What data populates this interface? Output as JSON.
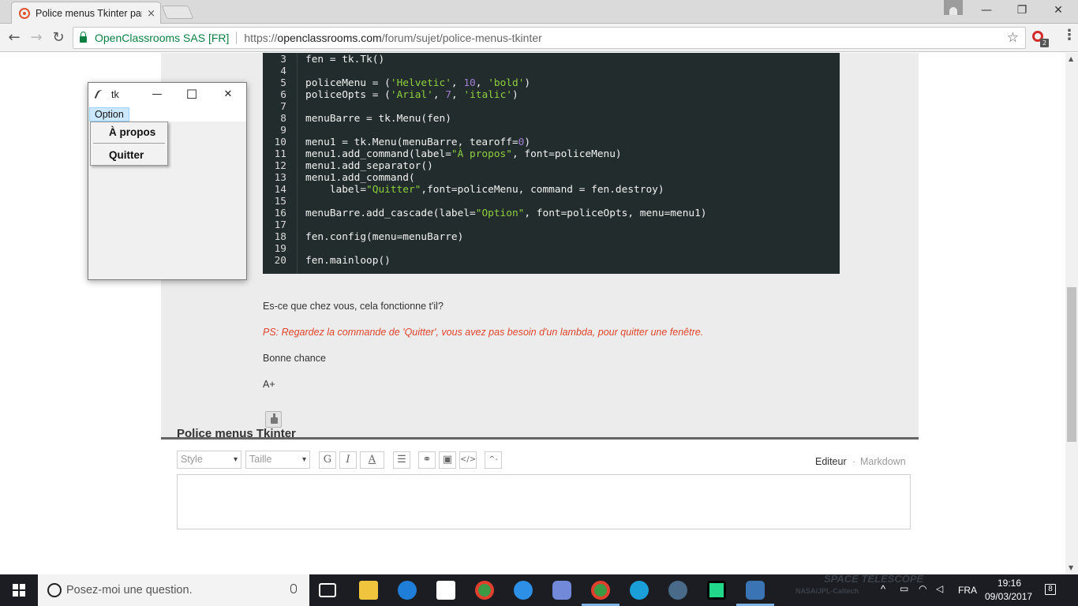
{
  "browser": {
    "tab_title": "Police menus Tkinter par",
    "tab_close": "×",
    "site_name": "OpenClassrooms SAS [FR]",
    "url_scheme": "https://",
    "url_host": "openclassrooms.com",
    "url_path": "/forum/sujet/police-menus-tkinter",
    "back": "←",
    "forward": "→",
    "reload": "↻",
    "star": "☆",
    "menu": "⋮",
    "minimize": "—",
    "maximize": "❐",
    "close": "✕",
    "extension_badge": "2"
  },
  "code": {
    "lines": [
      {
        "n": "3",
        "text": "fen = tk.Tk()"
      },
      {
        "n": "4",
        "text": ""
      },
      {
        "n": "5",
        "parts": [
          [
            "policeMenu = (",
            ""
          ],
          [
            "'Helvetic'",
            "s"
          ],
          [
            ", ",
            ""
          ],
          [
            "10",
            "n"
          ],
          [
            ", ",
            ""
          ],
          [
            "'bold'",
            "s"
          ],
          [
            ")",
            ""
          ]
        ]
      },
      {
        "n": "6",
        "parts": [
          [
            "policeOpts = (",
            ""
          ],
          [
            "'Arial'",
            "s"
          ],
          [
            ", ",
            ""
          ],
          [
            "7",
            "n"
          ],
          [
            ", ",
            ""
          ],
          [
            "'italic'",
            "s"
          ],
          [
            ")",
            ""
          ]
        ]
      },
      {
        "n": "7",
        "text": ""
      },
      {
        "n": "8",
        "text": "menuBarre = tk.Menu(fen)"
      },
      {
        "n": "9",
        "text": ""
      },
      {
        "n": "10",
        "parts": [
          [
            "menu1 = tk.Menu(menuBarre, tearoff=",
            ""
          ],
          [
            "0",
            "n"
          ],
          [
            ")",
            ""
          ]
        ]
      },
      {
        "n": "11",
        "parts": [
          [
            "menu1.add_command(label=",
            ""
          ],
          [
            "\"À propos\"",
            "s"
          ],
          [
            ", font=policeMenu)",
            ""
          ]
        ]
      },
      {
        "n": "12",
        "text": "menu1.add_separator()"
      },
      {
        "n": "13",
        "text": "menu1.add_command("
      },
      {
        "n": "14",
        "parts": [
          [
            "    label=",
            ""
          ],
          [
            "\"Quitter\"",
            "s"
          ],
          [
            ",font=policeMenu, command = fen.destroy)",
            ""
          ]
        ]
      },
      {
        "n": "15",
        "text": ""
      },
      {
        "n": "16",
        "parts": [
          [
            "menuBarre.add_cascade(label=",
            ""
          ],
          [
            "\"Option\"",
            "s"
          ],
          [
            ", font=policeOpts, menu=menu1)",
            ""
          ]
        ]
      },
      {
        "n": "17",
        "text": ""
      },
      {
        "n": "18",
        "text": "fen.config(menu=menuBarre)"
      },
      {
        "n": "19",
        "text": ""
      },
      {
        "n": "20",
        "text": "fen.mainloop()"
      }
    ]
  },
  "post": {
    "question": "Es-ce que chez vous, cela fonctionne t'il?",
    "ps": "PS: Regardez la commande de 'Quitter', vous avez pas besoin d'un lambda, pour quitter une fenêtre.",
    "luck": "Bonne chance",
    "signoff": "A+"
  },
  "reply": {
    "title": "Police menus Tkinter",
    "style_placeholder": "Style",
    "size_placeholder": "Taille",
    "bold": "G",
    "italic": "I",
    "color": "A",
    "list": "☰",
    "link": "⚭",
    "image": "▣",
    "code": "</>",
    "formula": "^-",
    "mode_editor": "Editeur",
    "mode_dot": "·",
    "mode_markdown": "Markdown"
  },
  "tk_window": {
    "title": "tk",
    "minimize": "—",
    "maximize": "☐",
    "close": "✕",
    "menu_option": "Option",
    "item_about": "À propos",
    "item_quit": "Quitter"
  },
  "taskbar": {
    "search_placeholder": "Posez-moi une question.",
    "language": "FRA",
    "time": "19:16",
    "date": "09/03/2017",
    "notifications": "8",
    "wallpaper_text": "SPACE TELESCOPE",
    "wallpaper_subtext": "NASA/JPL-Caltech"
  },
  "colors": {
    "code_bg": "#232c2c",
    "string": "#8dd03f",
    "number": "#a17fd3",
    "ps_text": "#e0442a",
    "secure": "#0b8043",
    "tk_highlight": "#cce8ff"
  }
}
